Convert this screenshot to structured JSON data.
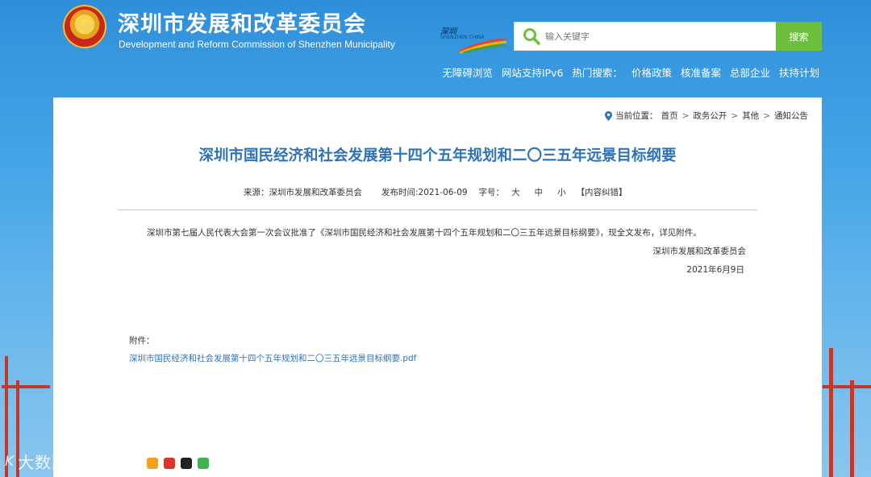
{
  "header": {
    "site_title": "深圳市发展和改革委员会",
    "site_subtitle": "Development and Reform Commission of Shenzhen Municipality",
    "logo_text": "深圳",
    "logo_sub": "SHENZHEN CHINA",
    "search": {
      "placeholder": "输入关键字",
      "button_label": "搜索"
    },
    "links": [
      "无障碍浏览",
      "网站支持IPv6",
      "热门搜索：",
      "价格政策",
      "核准备案",
      "总部企业",
      "扶持计划"
    ]
  },
  "breadcrumb": {
    "prefix": "当前位置：",
    "items": [
      "首页",
      "政务公开",
      "其他",
      "通知公告"
    ]
  },
  "article": {
    "title": "深圳市国民经济和社会发展第十四个五年规划和二〇三五年远景目标纲要",
    "source": "来源：深圳市发展和改革委员会",
    "publish_time": "发布时间:2021-06-09",
    "font_size_label": "字号：",
    "font_sizes": [
      "大",
      "中",
      "小"
    ],
    "correction": "【内容纠错】",
    "body": "深圳市第七届人民代表大会第一次会议批准了《深圳市国民经济和社会发展第十四个五年规划和二〇三五年远景目标纲要》，现全文发布，详见附件。",
    "signature_org": "深圳市发展和改革委员会",
    "signature_date": "2021年6月9日",
    "attachment_label": "附件：",
    "attachment_link": "深圳市国民经济和社会发展第十四个五年规划和二〇三五年远景目标纲要.pdf"
  },
  "watermark": {
    "text": "大数跨境",
    "logo": "K"
  },
  "colors": {
    "accent": "#2e72b8",
    "search_button": "#6cbf3a",
    "background": "#3a9be2"
  }
}
